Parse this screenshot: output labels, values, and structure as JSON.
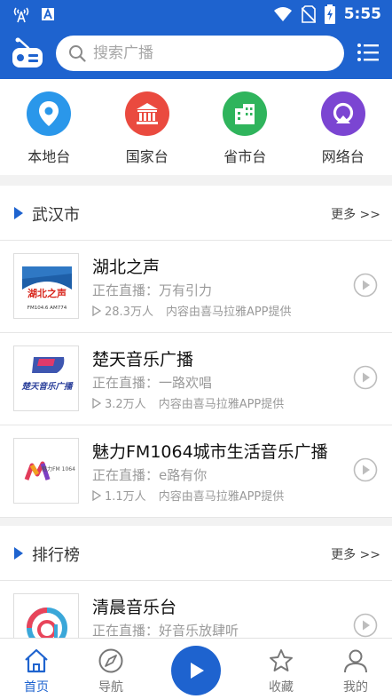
{
  "status": {
    "time": "5:55"
  },
  "search": {
    "placeholder": "搜索广播"
  },
  "categories": [
    {
      "label": "本地台",
      "icon": "location-icon",
      "color": "#2a97ea"
    },
    {
      "label": "国家台",
      "icon": "government-icon",
      "color": "#ea4a3f"
    },
    {
      "label": "省市台",
      "icon": "building-icon",
      "color": "#2fb45c"
    },
    {
      "label": "网络台",
      "icon": "network-icon",
      "color": "#7b45d2"
    }
  ],
  "sections": [
    {
      "title": "武汉市",
      "more": "更多 >>",
      "stations": [
        {
          "name": "湖北之声",
          "live": "正在直播：万有引力",
          "listeners": "28.3万人",
          "source": "内容由喜马拉雅APP提供",
          "logo_text": "湖北之声",
          "logo_sub": "FM104.6 AM774"
        },
        {
          "name": "楚天音乐广播",
          "live": "正在直播：一路欢唱",
          "listeners": "3.2万人",
          "source": "内容由喜马拉雅APP提供",
          "logo_text": "楚天音乐广播"
        },
        {
          "name": "魅力FM1064城市生活音乐广播",
          "live": "正在直播：e路有你",
          "listeners": "1.1万人",
          "source": "内容由喜马拉雅APP提供",
          "logo_text": "魅力FM 1064"
        }
      ]
    },
    {
      "title": "排行榜",
      "more": "更多 >>",
      "stations": [
        {
          "name": "清晨音乐台",
          "live": "正在直播：好音乐放肆听"
        }
      ]
    }
  ],
  "bottom_nav": [
    {
      "label": "首页",
      "icon": "home-icon",
      "active": true
    },
    {
      "label": "导航",
      "icon": "compass-icon",
      "active": false
    },
    {
      "label": "收藏",
      "icon": "star-icon",
      "active": false
    },
    {
      "label": "我的",
      "icon": "user-icon",
      "active": false
    }
  ],
  "colors": {
    "primary": "#1e63cf"
  }
}
